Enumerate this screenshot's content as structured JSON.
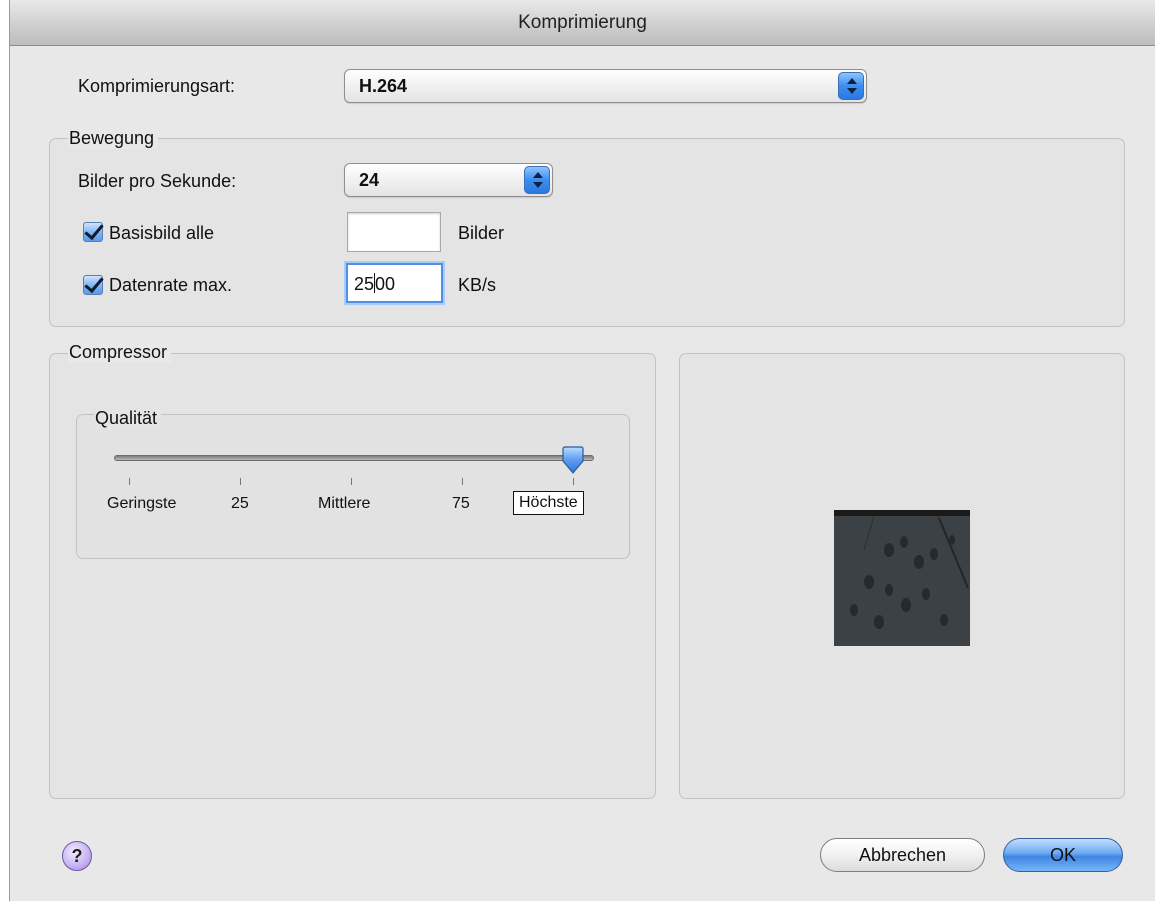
{
  "window": {
    "title": "Komprimierung"
  },
  "compression": {
    "label": "Komprimierungsart:",
    "value": "H.264"
  },
  "motion": {
    "title": "Bewegung",
    "fps_label": "Bilder pro Sekunde:",
    "fps_value": "24",
    "keyframe": {
      "label": "Basisbild alle",
      "checked": true,
      "value": "",
      "unit": "Bilder"
    },
    "datarate": {
      "label": "Datenrate max.",
      "checked": true,
      "value_before_caret": "25",
      "value_after_caret": "00",
      "unit": "KB/s"
    }
  },
  "compressor": {
    "title": "Compressor",
    "quality": {
      "title": "Qualität",
      "level": 1.0,
      "ticks": [
        "Geringste",
        "25",
        "Mittlere",
        "75",
        "Höchste"
      ],
      "selected_tick": "Höchste"
    }
  },
  "buttons": {
    "help": "?",
    "cancel": "Abbrechen",
    "ok": "OK"
  },
  "colors": {
    "accent": "#3d8ef0",
    "window_bg": "#e8e8e8",
    "help_purple": "#c6b0f3"
  }
}
